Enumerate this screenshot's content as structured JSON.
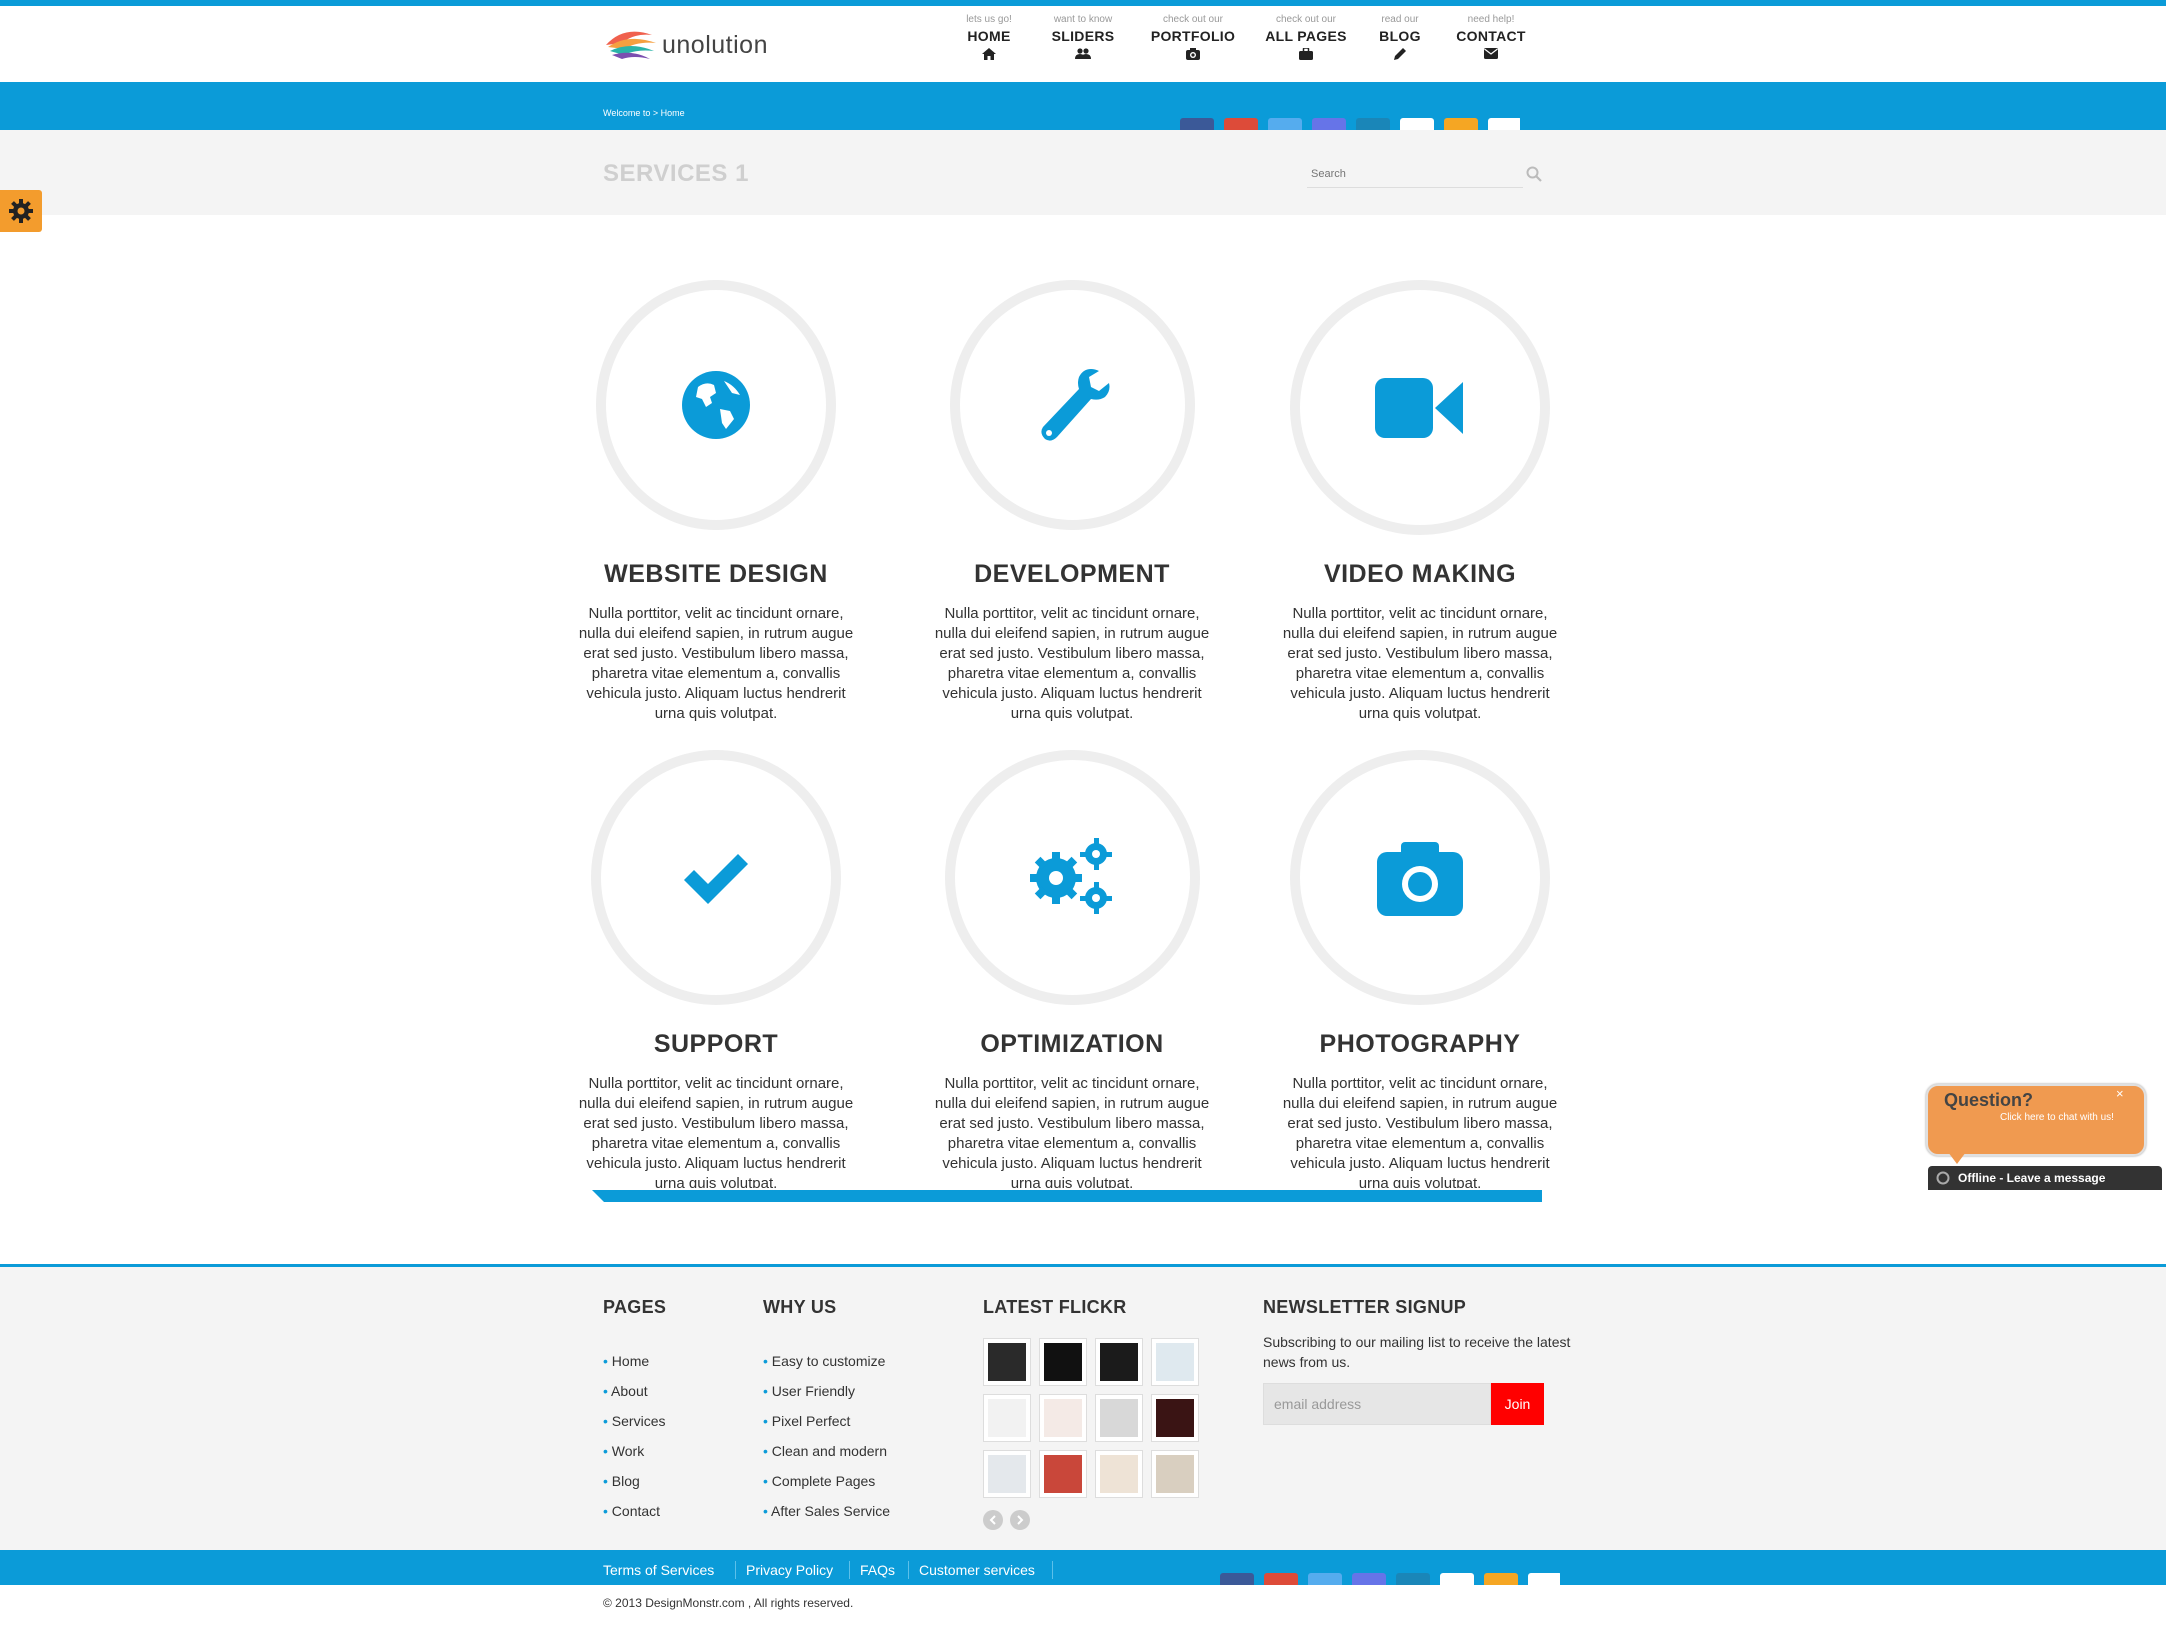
{
  "colors": {
    "accent": "#0b9bd8",
    "settings_tab": "#f39c2d",
    "join_button": "#ff0000",
    "chat_bubble": "#f09a50"
  },
  "header": {
    "logo_text": "unolution",
    "nav": [
      {
        "sub": "lets us go!",
        "label": "HOME",
        "icon": "home-icon"
      },
      {
        "sub": "want to know",
        "label": "SLIDERS",
        "icon": "users-icon"
      },
      {
        "sub": "check out our",
        "label": "PORTFOLIO",
        "icon": "camera-icon"
      },
      {
        "sub": "check out our",
        "label": "ALL PAGES",
        "icon": "briefcase-icon"
      },
      {
        "sub": "read our",
        "label": "BLOG",
        "icon": "pencil-icon"
      },
      {
        "sub": "need help!",
        "label": "CONTACT",
        "icon": "envelope-icon"
      }
    ]
  },
  "breadcrumb": "Welcome to > Home",
  "social_icons": [
    "facebook-icon",
    "google-plus-icon",
    "twitter-icon",
    "google-icon",
    "linkedin-icon",
    "paypal-icon",
    "amazon-icon",
    "dropbox-icon"
  ],
  "page": {
    "title": "SERVICES 1",
    "search_placeholder": "Search"
  },
  "services": [
    {
      "title": "WEBSITE DESIGN",
      "icon": "globe-icon",
      "text": "Nulla porttitor, velit ac tincidunt ornare, nulla dui eleifend sapien, in rutrum augue erat sed justo. Vestibulum libero massa, pharetra vitae elementum a, convallis vehicula justo. Aliquam luctus hendrerit urna quis volutpat."
    },
    {
      "title": "DEVELOPMENT",
      "icon": "wrench-icon",
      "text": "Nulla porttitor, velit ac tincidunt ornare, nulla dui eleifend sapien, in rutrum augue erat sed justo. Vestibulum libero massa, pharetra vitae elementum a, convallis vehicula justo. Aliquam luctus hendrerit urna quis volutpat."
    },
    {
      "title": "VIDEO MAKING",
      "icon": "video-camera-icon",
      "text": "Nulla porttitor, velit ac tincidunt ornare, nulla dui eleifend sapien, in rutrum augue erat sed justo. Vestibulum libero massa, pharetra vitae elementum a, convallis vehicula justo. Aliquam luctus hendrerit urna quis volutpat."
    },
    {
      "title": "SUPPORT",
      "icon": "check-icon",
      "text": "Nulla porttitor, velit ac tincidunt ornare, nulla dui eleifend sapien, in rutrum augue erat sed justo. Vestibulum libero massa, pharetra vitae elementum a, convallis vehicula justo. Aliquam luctus hendrerit urna quis volutpat."
    },
    {
      "title": "OPTIMIZATION",
      "icon": "gears-icon",
      "text": "Nulla porttitor, velit ac tincidunt ornare, nulla dui eleifend sapien, in rutrum augue erat sed justo. Vestibulum libero massa, pharetra vitae elementum a, convallis vehicula justo. Aliquam luctus hendrerit urna quis volutpat."
    },
    {
      "title": "PHOTOGRAPHY",
      "icon": "photo-camera-icon",
      "text": "Nulla porttitor, velit ac tincidunt ornare, nulla dui eleifend sapien, in rutrum augue erat sed justo. Vestibulum libero massa, pharetra vitae elementum a, convallis vehicula justo. Aliquam luctus hendrerit urna quis volutpat."
    }
  ],
  "footer": {
    "pages": {
      "title": "PAGES",
      "items": [
        "Home",
        "About",
        "Services",
        "Work",
        "Blog",
        "Contact"
      ]
    },
    "why": {
      "title": "WHY US",
      "items": [
        "Easy to customize",
        "User Friendly",
        "Pixel Perfect",
        "Clean and modern",
        "Complete Pages",
        "After Sales Service"
      ]
    },
    "flickr": {
      "title": "LATEST FLICKR"
    },
    "newsletter": {
      "title": "NEWSLETTER SIGNUP",
      "desc": "Subscribing to our mailing list to receive the latest news from us.",
      "placeholder": "email address",
      "button": "Join"
    },
    "links": [
      "Terms of Services",
      "Privacy Policy",
      "FAQs",
      "Customer services"
    ],
    "copyright": "© 2013 DesignMonstr.com , All rights reserved."
  },
  "chat": {
    "question": "Question?",
    "sub": "Click here to chat with us!",
    "close": "×",
    "status": "Offline - Leave a message"
  }
}
